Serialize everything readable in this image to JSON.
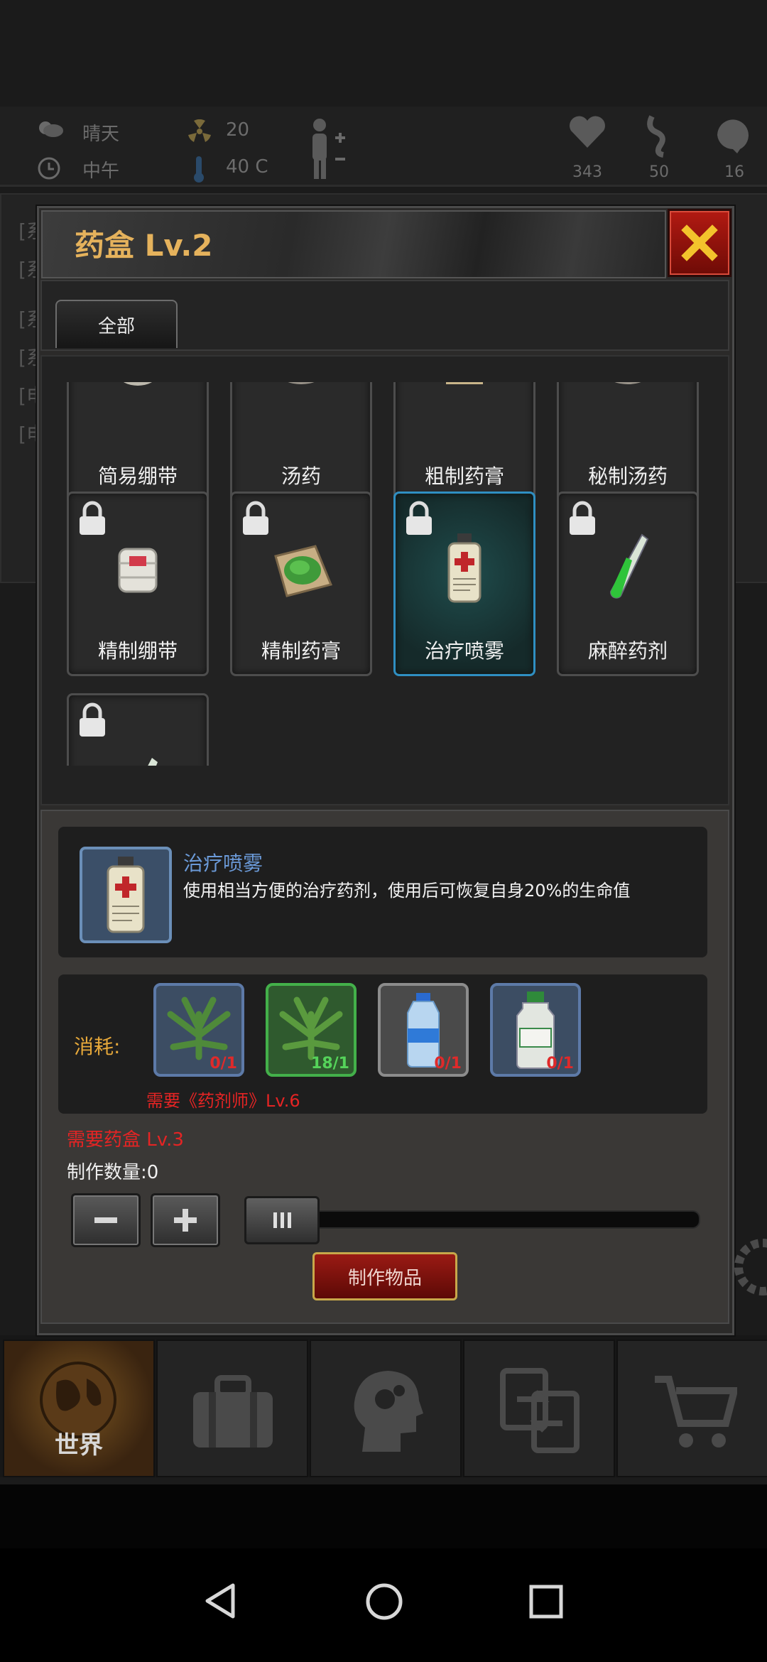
{
  "status": {
    "weather": "晴天",
    "time_of_day": "中午",
    "radiation": "20",
    "temperature": "40 C",
    "health": "343",
    "stomach": "50",
    "mood": "16"
  },
  "background_log": [
    "[系",
    "[系",
    "[系",
    "[系",
    "[电",
    "[电"
  ],
  "modal": {
    "title": "药盒 Lv.2",
    "tabs": [
      {
        "label": "全部"
      }
    ],
    "grid_items": [
      {
        "label": "简易绷带",
        "locked": false
      },
      {
        "label": "汤药",
        "locked": false
      },
      {
        "label": "粗制药膏",
        "locked": false
      },
      {
        "label": "秘制汤药",
        "locked": false
      },
      {
        "label": "精制绷带",
        "locked": true
      },
      {
        "label": "精制药膏",
        "locked": true
      },
      {
        "label": "治疗喷雾",
        "locked": true,
        "selected": true
      },
      {
        "label": "麻醉药剂",
        "locked": true
      },
      {
        "label": "",
        "locked": true
      }
    ],
    "selected": {
      "name": "治疗喷雾",
      "description": "使用相当方便的治疗药剂，使用后可恢复自身20%的生命值"
    },
    "consume_label": "消耗:",
    "materials": [
      {
        "icon": "herb-leaf-icon",
        "count": "0/1"
      },
      {
        "icon": "herb-leaf-icon",
        "count": "18/1"
      },
      {
        "icon": "water-bottle-icon",
        "count": "0/1"
      },
      {
        "icon": "medicine-bottle-icon",
        "count": "0/1"
      }
    ],
    "skill_requirement": "需要《药剂师》Lv.6",
    "box_requirement": "需要药盒 Lv.3",
    "quantity_label": "制作数量:0",
    "quantity_fraction": 0,
    "craft_label": "制作物品"
  },
  "nav": {
    "tabs": [
      {
        "label": "世界",
        "icon": "globe-icon",
        "active": true
      },
      {
        "label": "",
        "icon": "backpack-icon"
      },
      {
        "label": "",
        "icon": "head-gears-icon"
      },
      {
        "label": "",
        "icon": "exchange-icon"
      },
      {
        "label": "",
        "icon": "cart-icon"
      }
    ]
  },
  "colors": {
    "title": "#e5b25c",
    "selected_border": "#2f8fc2",
    "item_name": "#6b9ad8",
    "warning": "#e42424",
    "consume": "#e6a83a"
  }
}
